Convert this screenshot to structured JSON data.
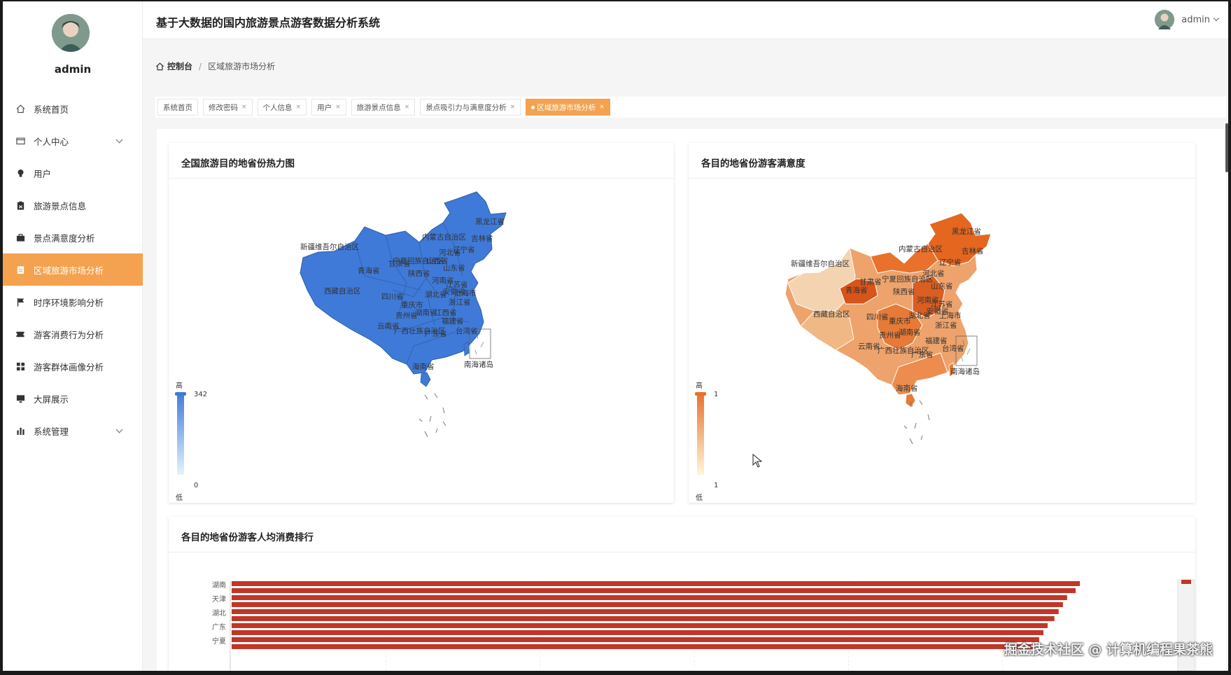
{
  "sidebar": {
    "username": "admin",
    "items": [
      {
        "label": "系统首页",
        "icon": "home-icon",
        "active": false,
        "expandable": false
      },
      {
        "label": "个人中心",
        "icon": "profile-card-icon",
        "active": false,
        "expandable": true
      },
      {
        "label": "用户",
        "icon": "bulb-icon",
        "active": false,
        "expandable": false
      },
      {
        "label": "旅游景点信息",
        "icon": "clipboard-icon",
        "active": false,
        "expandable": false
      },
      {
        "label": "景点满意度分析",
        "icon": "briefcase-icon",
        "active": false,
        "expandable": false
      },
      {
        "label": "区域旅游市场分析",
        "icon": "document-icon",
        "active": true,
        "expandable": false
      },
      {
        "label": "时序环境影响分析",
        "icon": "flag-icon",
        "active": false,
        "expandable": false
      },
      {
        "label": "游客消费行为分析",
        "icon": "ticket-icon",
        "active": false,
        "expandable": false
      },
      {
        "label": "游客群体画像分析",
        "icon": "grid-icon",
        "active": false,
        "expandable": false
      },
      {
        "label": "大屏展示",
        "icon": "monitor-icon",
        "active": false,
        "expandable": false
      },
      {
        "label": "系统管理",
        "icon": "bar-chart-icon",
        "active": false,
        "expandable": true
      }
    ]
  },
  "header": {
    "title": "基于大数据的国内旅游景点游客数据分析系统",
    "user": "admin"
  },
  "breadcrumb": {
    "home": "控制台",
    "separator": "/",
    "current": "区域旅游市场分析"
  },
  "tabs": [
    {
      "label": "系统首页",
      "closable": false,
      "active": false
    },
    {
      "label": "修改密码",
      "closable": true,
      "active": false
    },
    {
      "label": "个人信息",
      "closable": true,
      "active": false
    },
    {
      "label": "用户",
      "closable": true,
      "active": false
    },
    {
      "label": "旅游景点信息",
      "closable": true,
      "active": false
    },
    {
      "label": "景点吸引力与满意度分析",
      "closable": true,
      "active": false
    },
    {
      "label": "区域旅游市场分析",
      "closable": true,
      "active": true
    }
  ],
  "close_glyph": "×",
  "colors": {
    "accent": "#f4a24f",
    "heat_blue": "#3f7ad8",
    "satisfaction_orange": "#e8702a",
    "bar_red": "#c23527"
  },
  "cards": {
    "heatmap_title": "全国旅游目的地省份热力图",
    "satisfaction_title": "各目的地省份游客满意度",
    "spend_title": "各目的地省份游客人均消费排行"
  },
  "chart_data": [
    {
      "type": "heatmap",
      "title": "全国旅游目的地省份热力图",
      "visual_map": {
        "high_label": "高",
        "low_label": "低",
        "max": "342",
        "min": "0"
      },
      "region_labels": [
        "黑龙江省",
        "吉林省",
        "内蒙古自治区",
        "辽宁省",
        "新疆维吾尔自治区",
        "青海省",
        "甘肃省",
        "宁夏回族自治区",
        "陕西省",
        "山西省",
        "河北省",
        "山东省",
        "河南省",
        "江苏省",
        "西藏自治区",
        "四川省",
        "湖北省",
        "安徽省",
        "上海市",
        "浙江省",
        "重庆市",
        "贵州省",
        "湖南省",
        "江西省",
        "福建省",
        "云南省",
        "广西壮族自治区",
        "广东省",
        "台湾省",
        "海南省",
        "南海诸岛"
      ]
    },
    {
      "type": "heatmap",
      "title": "各目的地省份游客满意度",
      "visual_map": {
        "high_label": "高",
        "low_label": "低",
        "max": "1",
        "min": "1"
      },
      "region_labels": [
        "黑龙江省",
        "吉林省",
        "内蒙古自治区",
        "辽宁省",
        "新疆维吾尔自治区",
        "青海省",
        "甘肃省",
        "宁夏回族自治区",
        "陕西省",
        "河北省",
        "山东省",
        "河南省",
        "江苏省",
        "西藏自治区",
        "四川省",
        "湖北省",
        "安徽省",
        "上海市",
        "浙江省",
        "重庆市",
        "贵州省",
        "湖南省",
        "福建省",
        "云南省",
        "广西壮族自治区",
        "广东省",
        "台湾省",
        "海南省",
        "南海诸岛"
      ]
    },
    {
      "type": "bar",
      "title": "各目的地省份游客人均消费排行",
      "orientation": "horizontal",
      "categories": [
        "湖南",
        "天津",
        "湖北",
        "广东",
        "宁夏"
      ],
      "series": [
        {
          "values": [
            1000,
            985,
            975,
            962,
            952
          ]
        }
      ],
      "note": "values estimated relative to the longest bar; no axis ticks visible"
    }
  ],
  "watermark": "掘金技术社区 @ 计算机编程果茶熊"
}
